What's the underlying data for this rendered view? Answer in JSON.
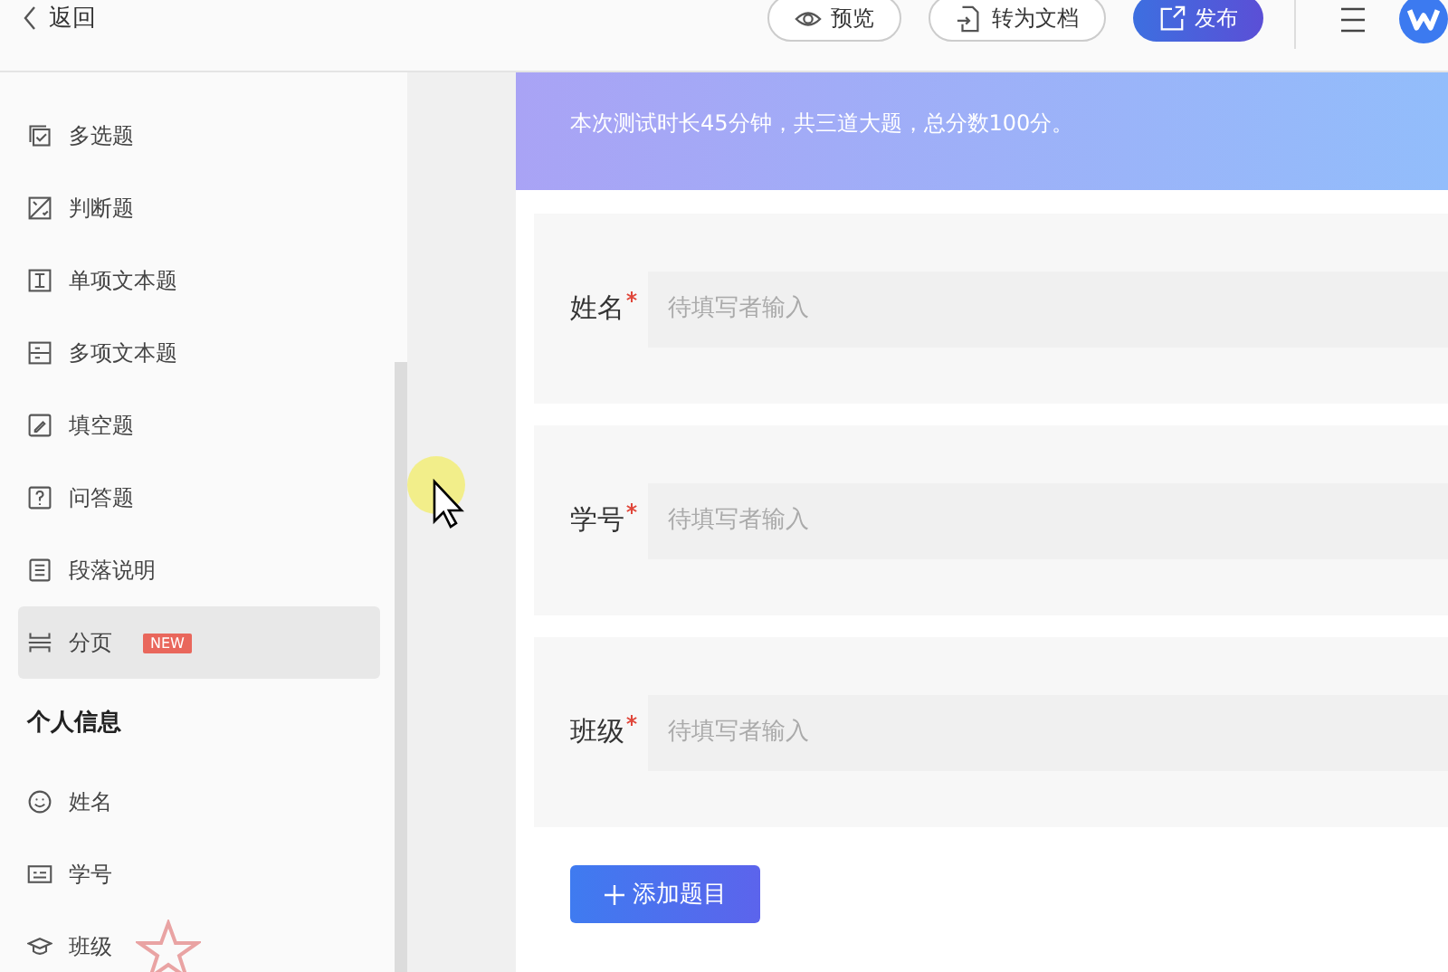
{
  "header": {
    "back_label": "返回",
    "buttons": [
      {
        "label": "预览",
        "kind": "preview"
      },
      {
        "label": "转为文档",
        "kind": "convert"
      },
      {
        "label": "发布",
        "kind": "publish"
      }
    ]
  },
  "sidebar": {
    "items": [
      {
        "label": "多选题",
        "selected": false
      },
      {
        "label": "判断题",
        "selected": false
      },
      {
        "label": "单项文本题",
        "selected": false
      },
      {
        "label": "多项文本题",
        "selected": false
      },
      {
        "label": "填空题",
        "selected": false
      },
      {
        "label": "问答题",
        "selected": false
      },
      {
        "label": "段落说明",
        "selected": false
      },
      {
        "label": "分页",
        "selected": true,
        "badge": "NEW"
      }
    ],
    "section_title": "个人信息",
    "section_items": [
      {
        "label": "姓名",
        "selected": false
      },
      {
        "label": "学号",
        "selected": false
      },
      {
        "label": "班级",
        "selected": false
      }
    ]
  },
  "banner": {
    "description": "本次测试时长45分钟，共三道大题，总分数100分。"
  },
  "form": {
    "fields": [
      {
        "label": "姓名",
        "required": true,
        "placeholder": "待填写者输入"
      },
      {
        "label": "学号",
        "required": true,
        "placeholder": "待填写者输入"
      },
      {
        "label": "班级",
        "required": true,
        "placeholder": "待填写者输入"
      }
    ],
    "add_button": "添加题目"
  }
}
